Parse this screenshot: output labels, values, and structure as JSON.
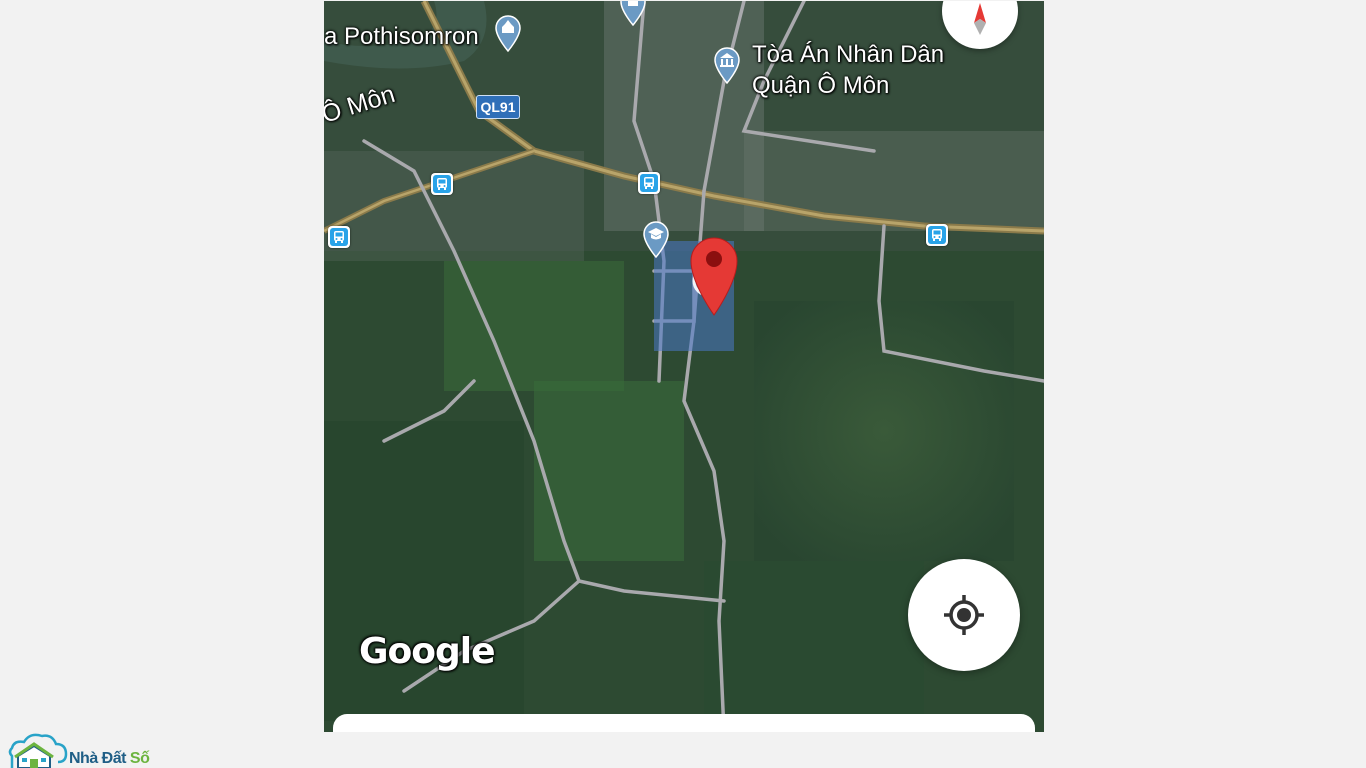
{
  "map": {
    "labels": {
      "pothisomron": "a Pothisomron",
      "court": "Tòa Án Nhân Dân Quận Ô Môn",
      "district": "Ô Môn"
    },
    "road_shield": "QL91",
    "attribution": "Google",
    "icons": {
      "bus_stop": "bus-icon",
      "temple": "temple-icon",
      "court": "courthouse-icon",
      "school": "school-icon",
      "pin": "location-pin-icon",
      "compass": "compass-icon",
      "locate": "my-location-icon"
    },
    "colors": {
      "pin": "#e53935",
      "bus": "#29a3e8",
      "shield": "#2f6fb8",
      "poi": "#6b9ac4"
    }
  },
  "watermark": {
    "part1": "Nhà Đất",
    "part2": "Số"
  }
}
